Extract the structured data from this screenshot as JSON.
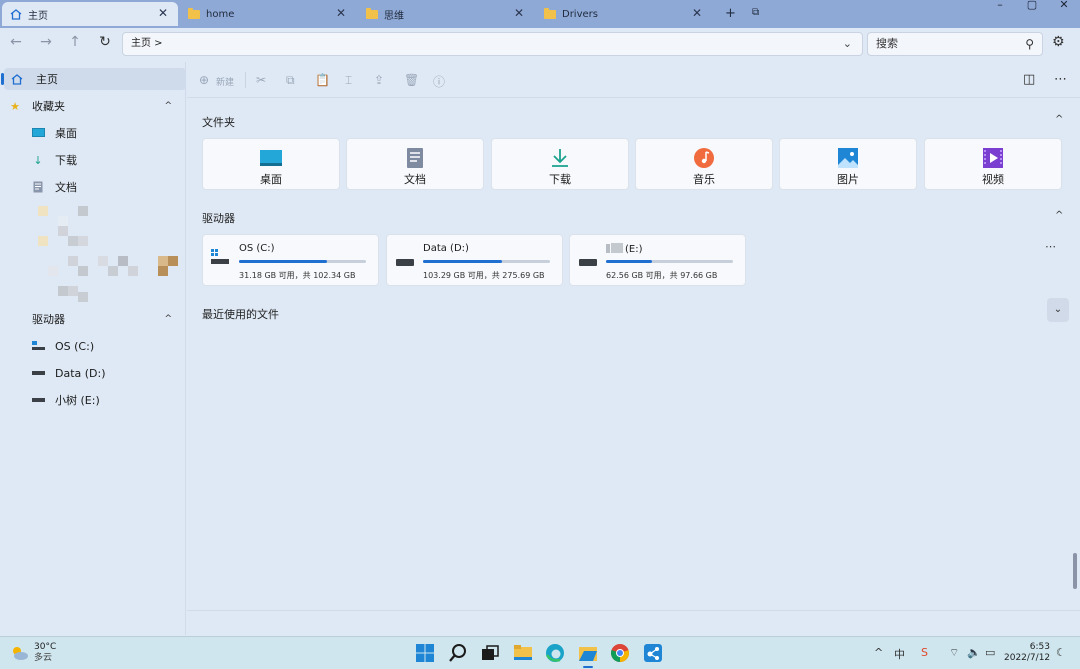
{
  "window": {
    "tabs": [
      {
        "label": "主页",
        "active": true
      },
      {
        "label": "home",
        "active": false
      },
      {
        "label": "思维",
        "active": false
      },
      {
        "label": "Drivers",
        "active": false
      }
    ],
    "new_tab_glyph": "+",
    "controls": {
      "minimize": "–",
      "maximize": "▢",
      "close": "✕"
    }
  },
  "address": {
    "path": "主页  >",
    "search_placeholder": "搜索"
  },
  "sidebar": {
    "home": "主页",
    "favorites": "收藏夹",
    "fav_items": [
      "桌面",
      "下载",
      "文档"
    ],
    "drives_header": "驱动器",
    "drives": [
      "OS (C:)",
      "Data (D:)",
      "小树 (E:)"
    ]
  },
  "toolbar": {
    "new_label": "新建"
  },
  "main": {
    "folders_title": "文件夹",
    "folders": [
      {
        "label": "桌面",
        "icon": "desktop-icon",
        "color": "#22a7d8"
      },
      {
        "label": "文档",
        "icon": "document-icon",
        "color": "#7e8aa0"
      },
      {
        "label": "下载",
        "icon": "download-icon",
        "color": "#1ba28e"
      },
      {
        "label": "音乐",
        "icon": "music-icon",
        "color": "#f06b3e"
      },
      {
        "label": "图片",
        "icon": "pictures-icon",
        "color": "#1f86d6"
      },
      {
        "label": "视频",
        "icon": "video-icon",
        "color": "#7a3fd0"
      }
    ],
    "drives_title": "驱动器",
    "drives": [
      {
        "name": "OS (C:)",
        "size": "31.18 GB 可用，共 102.34 GB",
        "used": 0.695
      },
      {
        "name": "Data (D:)",
        "size": "103.29 GB 可用，共 275.69 GB",
        "used": 0.625
      },
      {
        "name": "(E:)",
        "size": "62.56 GB 可用，共 97.66 GB",
        "used": 0.36
      }
    ],
    "recent_title": "最近使用的文件"
  },
  "taskbar": {
    "temp": "30°C",
    "condition": "多云",
    "time": "6:53",
    "date": "2022/7/12"
  },
  "colors": {
    "accent": "#1f6fd1",
    "titlebar": "#8fa9d6",
    "background": "#dfe9f5",
    "taskbar": "#cfe6ee"
  }
}
